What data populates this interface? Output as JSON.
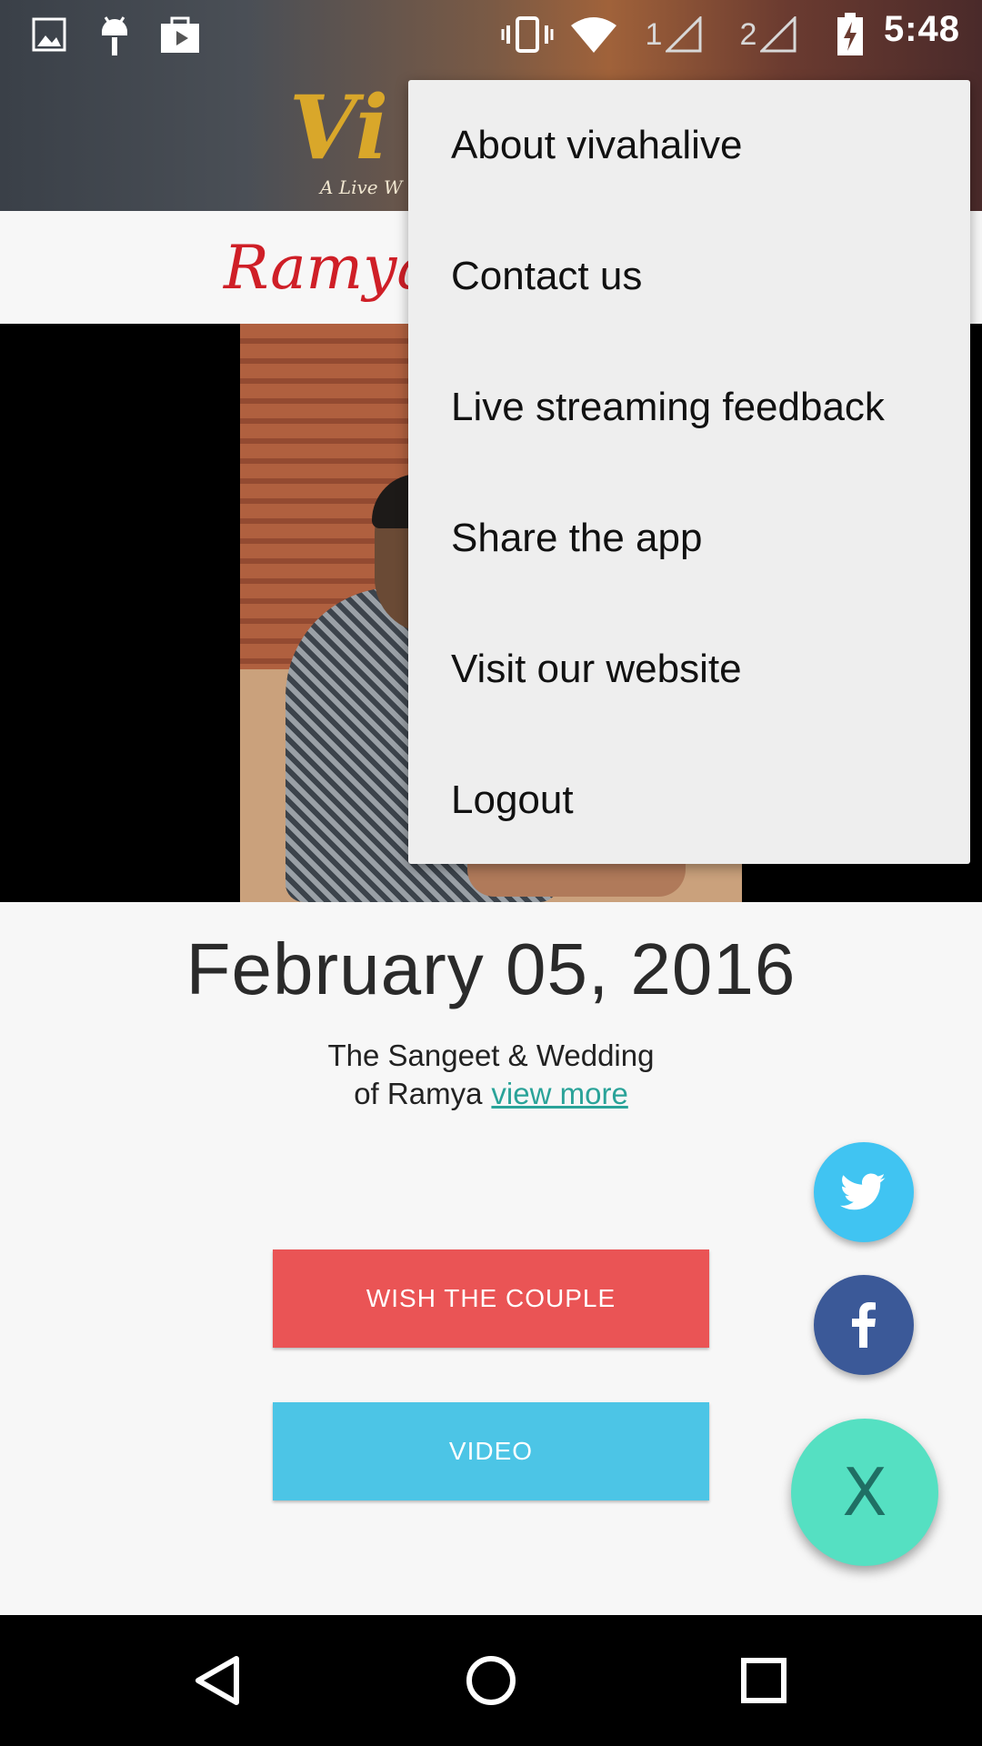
{
  "status_bar": {
    "time": "5:48",
    "sim1": "1",
    "sim2": "2",
    "icons": [
      "image-icon",
      "android-icon",
      "play-store-icon",
      "vibrate-icon",
      "wifi-icon",
      "signal-icon",
      "signal-icon",
      "battery-charging-icon"
    ]
  },
  "header": {
    "logo_text": "Vi",
    "logo_tagline": "A Live W"
  },
  "couple_name": "Ramya",
  "menu": {
    "items": [
      {
        "label": "About vivahalive"
      },
      {
        "label": "Contact us"
      },
      {
        "label": "Live streaming feedback"
      },
      {
        "label": "Share the app"
      },
      {
        "label": "Visit our website"
      },
      {
        "label": "Logout"
      }
    ]
  },
  "event": {
    "date": "February 05, 2016",
    "description_line1": "The Sangeet & Wedding",
    "description_line2": "of Ramya",
    "view_more": "view more"
  },
  "buttons": {
    "wish": "WISH THE COUPLE",
    "video": "VIDEO"
  },
  "fabs": {
    "close_label": "X",
    "twitter": "twitter-icon",
    "facebook": "facebook-icon"
  },
  "colors": {
    "wish_button": "#ea5455",
    "video_button": "#4cc5e6",
    "twitter": "#40c4f2",
    "facebook": "#3b5998",
    "close_fab": "#55e0c2",
    "link": "#2aa399",
    "name_red": "#cf1f27"
  }
}
